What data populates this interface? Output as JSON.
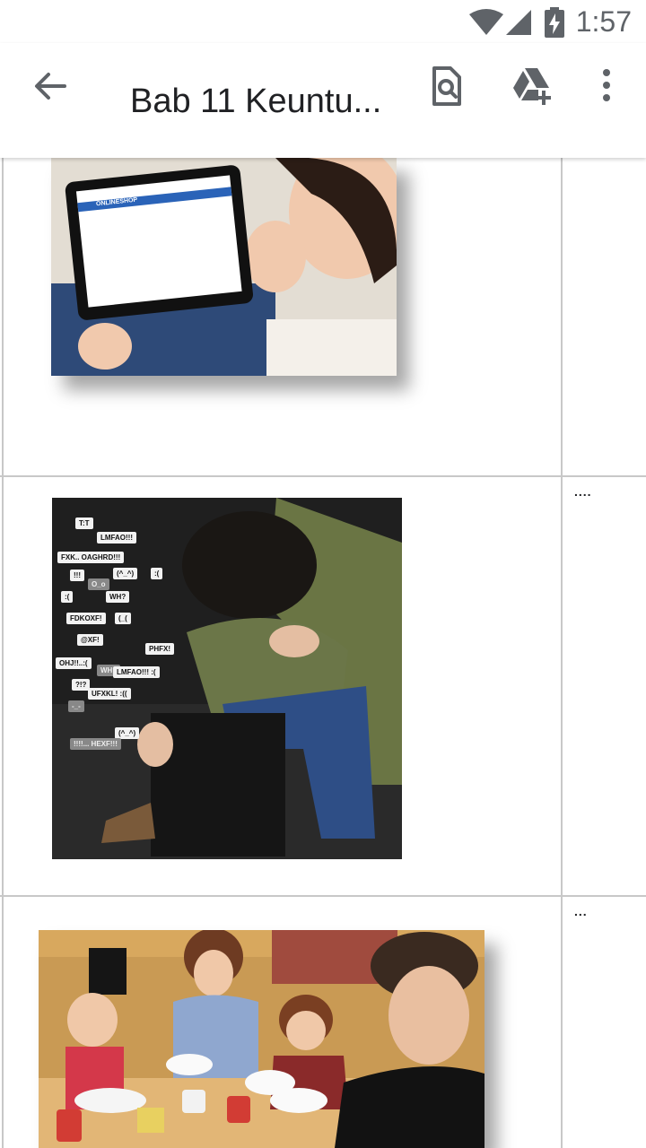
{
  "status_bar": {
    "time": "1:57",
    "icons": [
      "wifi-icon",
      "cellular-signal-icon",
      "battery-charging-icon"
    ]
  },
  "app_bar": {
    "title": "Bab 11 Keuntu...",
    "back_icon": "arrow-back-icon",
    "actions": [
      {
        "name": "find-in-document-icon"
      },
      {
        "name": "add-to-drive-icon"
      },
      {
        "name": "more-options-icon"
      }
    ]
  },
  "document": {
    "rows": [
      {
        "image": "woman-online-shopping-on-tablet",
        "tablet_text": "ONLINESHOP",
        "note": ""
      },
      {
        "image": "stressed-boy-with-chat-bubbles",
        "note": "...."
      },
      {
        "image": "family-at-breakfast-table-using-phones",
        "note": "..."
      }
    ],
    "chat_bubbles": [
      "T:T",
      "LMFAO!!!",
      "FXK.. OAGHRD!!!",
      "!!!",
      "(^_^)",
      ":(",
      "O_o",
      "WH?",
      ":(",
      "FDKOXF!",
      "(_(",
      "@XF!",
      "PHFX!",
      "OHJ!!..:(",
      "WH?",
      "LMFAO!!! :(",
      "?!?",
      "UFXKL! :((",
      "-_-",
      "(^_^)",
      "!!!!... HEXF!!!"
    ]
  },
  "colors": {
    "background": "#ffffff",
    "table_border": "#c8c8c8",
    "icon_gray": "#5f6368",
    "title_text": "#202124"
  }
}
